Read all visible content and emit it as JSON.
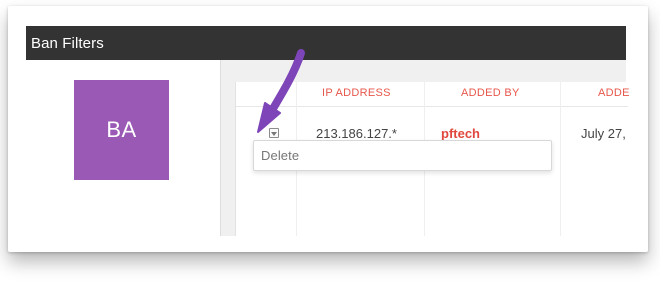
{
  "window": {
    "title": "Ban Filters"
  },
  "avatar": {
    "initials": "BA",
    "color": "#9b59b6"
  },
  "table": {
    "columns": [
      "IP ADDRESS",
      "ADDED BY",
      "ADDE"
    ],
    "rows": [
      {
        "ip_address": "213.186.127.*",
        "added_by": "pftech",
        "date_added": "July 27,"
      }
    ],
    "header_color": "#e8574b"
  },
  "row_menu": {
    "items": [
      "Delete"
    ]
  },
  "annotation": {
    "pointer_color": "#7d45b8",
    "icon": "arrow-icon"
  }
}
